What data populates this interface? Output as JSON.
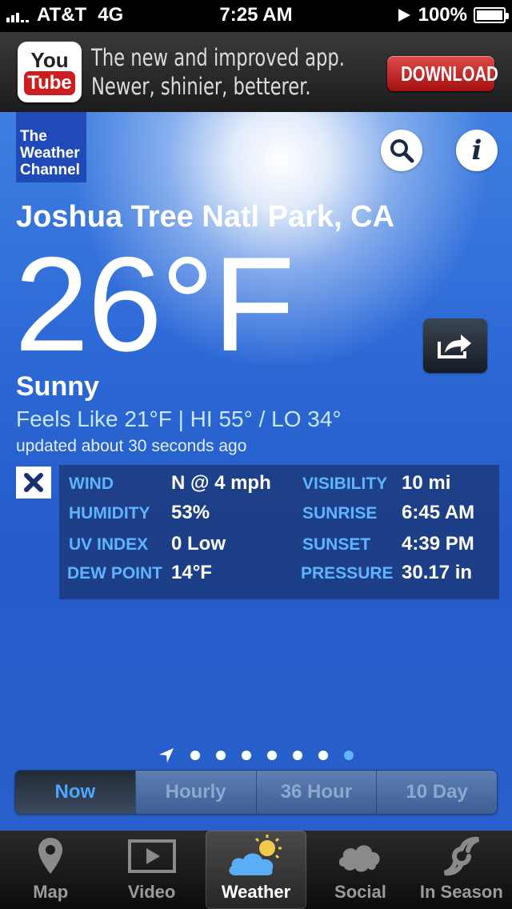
{
  "status_bar": {
    "carrier": "AT&T",
    "network": "4G",
    "time": "7:25 AM",
    "battery": "100%"
  },
  "ad": {
    "logo_you": "You",
    "logo_tube": "Tube",
    "line1": "The new and improved app.",
    "line2": "Newer, shinier, betterer.",
    "button": "DOWNLOAD"
  },
  "header": {
    "logo_line1": "The",
    "logo_line2": "Weather",
    "logo_line3": "Channel",
    "info_glyph": "i"
  },
  "weather": {
    "location": "Joshua Tree Natl Park, CA",
    "temperature": "26°F",
    "condition": "Sunny",
    "feels_like": "Feels Like 21°F | HI 55° / LO 34°",
    "updated": "updated about 30 seconds ago"
  },
  "details": {
    "wind_label": "WIND",
    "wind_value": "N @ 4 mph",
    "visibility_label": "VISIBILITY",
    "visibility_value": "10 mi",
    "humidity_label": "HUMIDITY",
    "humidity_value": "53%",
    "sunrise_label": "SUNRISE",
    "sunrise_value": "6:45 AM",
    "uv_label": "UV INDEX",
    "uv_value": "0 Low",
    "sunset_label": "SUNSET",
    "sunset_value": "4:39 PM",
    "dew_label": "DEW POINT",
    "dew_value": "14°F",
    "pressure_label": "PRESSURE",
    "pressure_value": "30.17 in"
  },
  "forecast_tabs": {
    "now": "Now",
    "hourly": "Hourly",
    "h36": "36 Hour",
    "d10": "10 Day"
  },
  "tabbar": {
    "map": "Map",
    "video": "Video",
    "weather": "Weather",
    "social": "Social",
    "in_season": "In Season"
  }
}
